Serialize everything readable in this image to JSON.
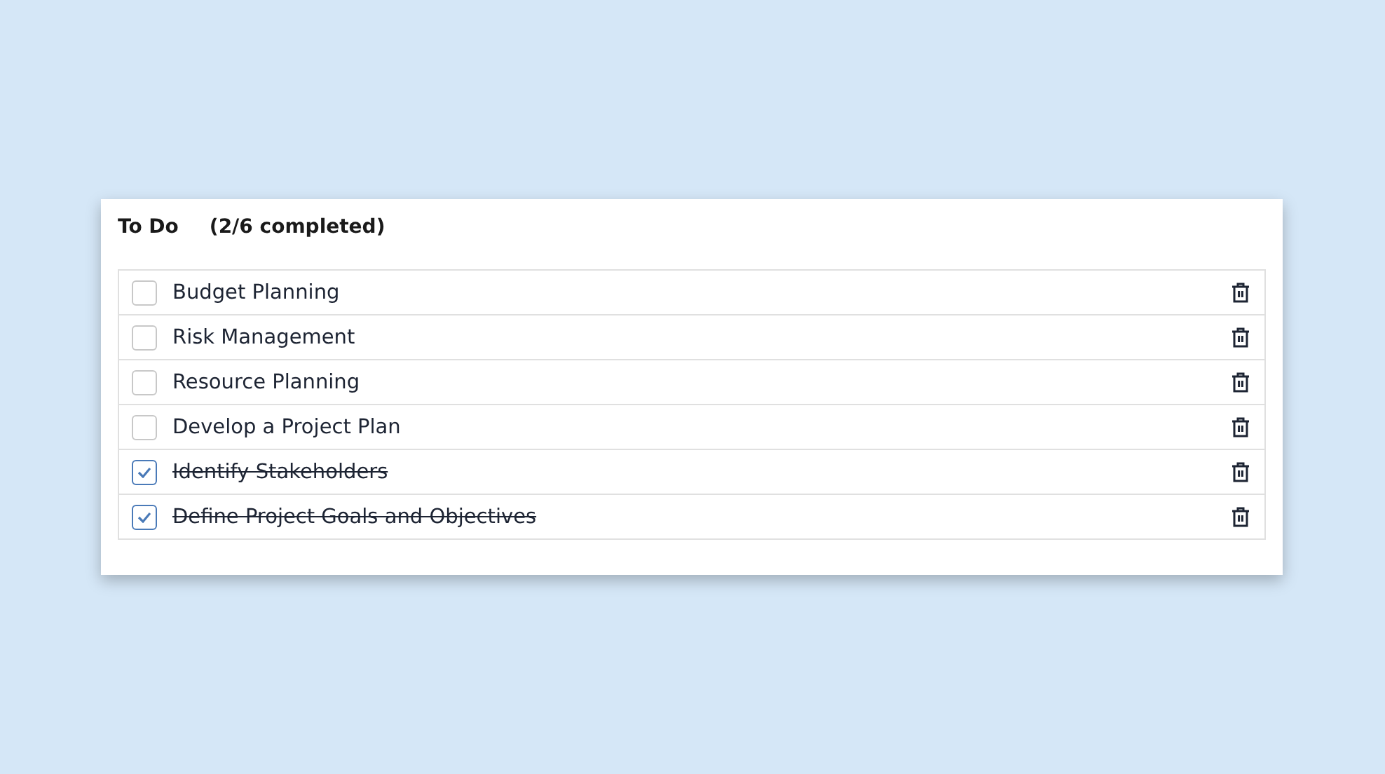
{
  "title": "To Do",
  "summary": "(2/6 completed)",
  "items": [
    {
      "label": "Budget Planning",
      "checked": false
    },
    {
      "label": "Risk Management",
      "checked": false
    },
    {
      "label": "Resource Planning",
      "checked": false
    },
    {
      "label": "Develop a Project Plan",
      "checked": false
    },
    {
      "label": "Identify Stakeholders",
      "checked": true
    },
    {
      "label": "Define Project Goals and Objectives",
      "checked": true
    }
  ]
}
